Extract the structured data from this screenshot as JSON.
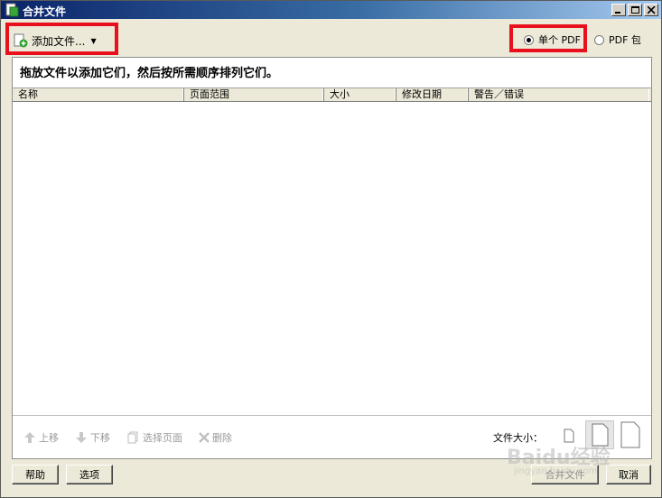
{
  "window": {
    "title": "合并文件"
  },
  "toolbar": {
    "add_files_label": "添加文件..."
  },
  "output_mode": {
    "options": [
      {
        "label": "单个 PDF",
        "selected": true
      },
      {
        "label": "PDF 包",
        "selected": false
      }
    ]
  },
  "panel": {
    "instruction": "拖放文件以添加它们，然后按所需顺序排列它们。",
    "columns": [
      "名称",
      "页面范围",
      "大小",
      "修改日期",
      "警告／错误"
    ]
  },
  "actions": {
    "move_up": "上移",
    "move_down": "下移",
    "select_pages": "选择页面",
    "delete": "删除"
  },
  "file_size": {
    "label": "文件大小："
  },
  "buttons": {
    "help": "帮助",
    "options": "选项",
    "combine": "合并文件",
    "cancel": "取消"
  },
  "watermark": {
    "brand": "Baidu经验",
    "url": "jingyan.baidu.com"
  },
  "colors": {
    "highlight": "#e8101c",
    "titlebar": "#0a246a"
  }
}
